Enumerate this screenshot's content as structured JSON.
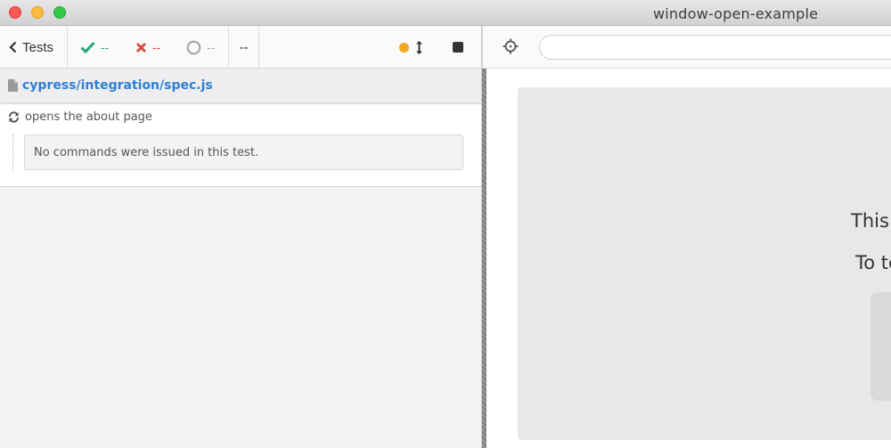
{
  "window": {
    "title": "window-open-example"
  },
  "reporter": {
    "back_label": "Tests",
    "stats": {
      "passed": "--",
      "failed": "--",
      "pending": "--",
      "duration": "--"
    },
    "status_dot_color": "#f5a623",
    "spec_path": "cypress/integration/spec.js",
    "test": {
      "title": "opens the about page",
      "empty_message": "No commands were issued in this test."
    }
  },
  "aut": {
    "url_value": "",
    "frame_text_1": "This",
    "frame_text_2": "To te"
  },
  "colors": {
    "pass": "#22a37b",
    "fail": "#d9473b",
    "pending": "#a8a8a8",
    "link": "#2d7fd3"
  }
}
